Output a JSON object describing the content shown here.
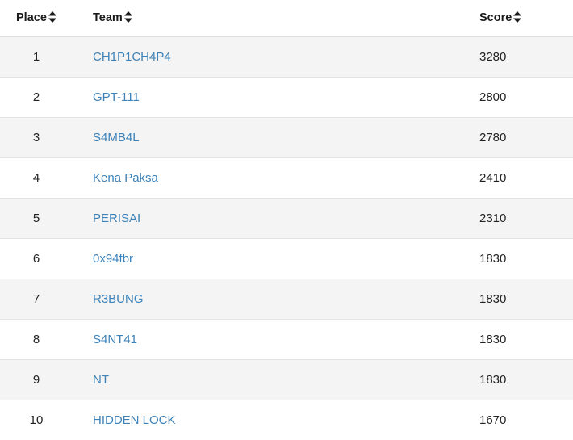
{
  "header": {
    "place": "Place",
    "team": "Team",
    "score": "Score"
  },
  "colors": {
    "link": "#3d82b8",
    "stripe": "#f4f4f4",
    "text": "#222222"
  },
  "icons": {
    "sort": "sort-icon"
  },
  "rows": [
    {
      "place": "1",
      "team": "CH1P1CH4P4",
      "score": "3280"
    },
    {
      "place": "2",
      "team": "GPT-111",
      "score": "2800"
    },
    {
      "place": "3",
      "team": "S4MB4L",
      "score": "2780"
    },
    {
      "place": "4",
      "team": "Kena Paksa",
      "score": "2410"
    },
    {
      "place": "5",
      "team": "PERISAI",
      "score": "2310"
    },
    {
      "place": "6",
      "team": "0x94fbr",
      "score": "1830"
    },
    {
      "place": "7",
      "team": "R3BUNG",
      "score": "1830"
    },
    {
      "place": "8",
      "team": "S4NT41",
      "score": "1830"
    },
    {
      "place": "9",
      "team": "NT",
      "score": "1830"
    },
    {
      "place": "10",
      "team": "HIDDEN LOCK",
      "score": "1670"
    }
  ]
}
